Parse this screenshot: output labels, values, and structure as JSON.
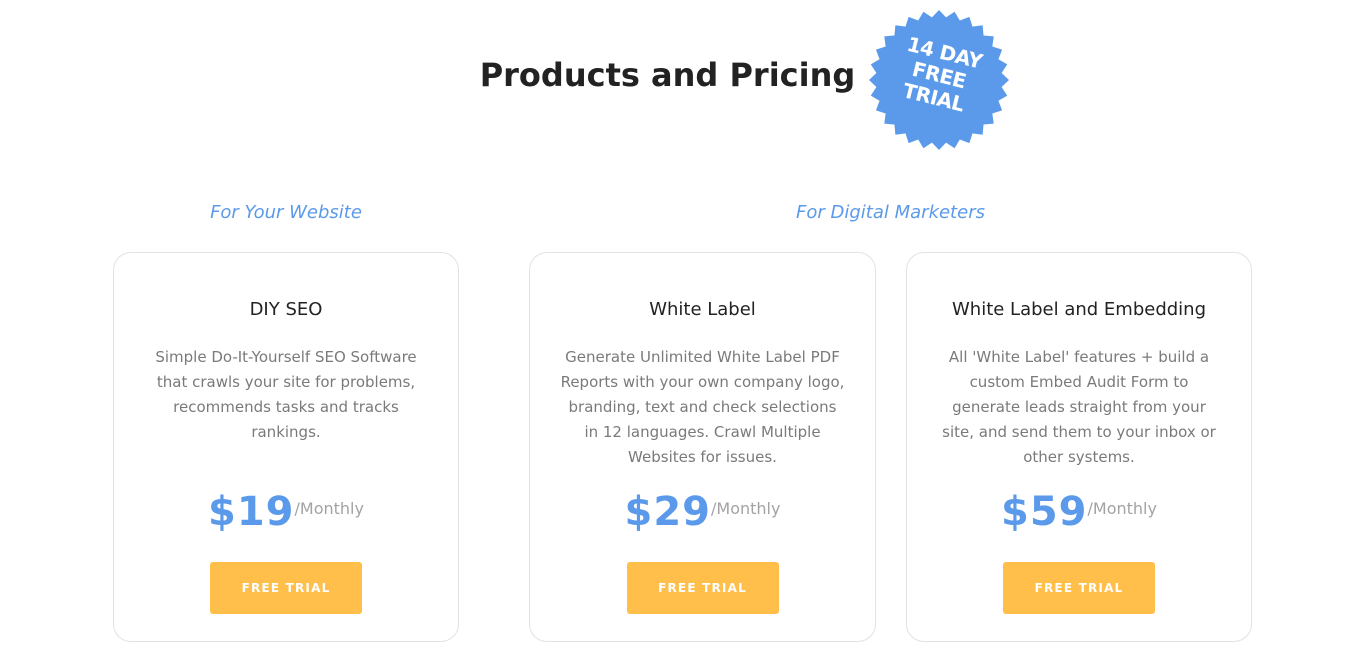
{
  "page": {
    "title": "Products and Pricing",
    "badge": {
      "line1": "14 DAY",
      "line2": "FREE",
      "line3": "TRIAL",
      "color": "#5b9aea"
    }
  },
  "sections": [
    {
      "heading": "For Your Website"
    },
    {
      "heading": "For Digital Marketers"
    }
  ],
  "plans": [
    {
      "name": "DIY SEO",
      "description": "Simple Do-It-Yourself SEO Software that crawls your site for problems, recommends tasks and tracks rankings.",
      "price": "$19",
      "period": "/Monthly",
      "cta": "FREE TRIAL"
    },
    {
      "name": "White Label",
      "description": "Generate Unlimited White Label PDF Reports with your own company logo, branding, text and check selections in 12 languages. Crawl Multiple Websites for issues.",
      "price": "$29",
      "period": "/Monthly",
      "cta": "FREE TRIAL"
    },
    {
      "name": "White Label and Embedding",
      "description": "All 'White Label' features + build a custom Embed Audit Form to generate leads straight from your site, and send them to your inbox or other systems.",
      "price": "$59",
      "period": "/Monthly",
      "cta": "FREE TRIAL"
    }
  ],
  "colors": {
    "accent": "#5b9aea",
    "button": "#ffbf4a",
    "title": "#222222",
    "body_text": "#7a7a7a",
    "muted": "#a3a3a3",
    "card_border": "#e3e3e3"
  }
}
